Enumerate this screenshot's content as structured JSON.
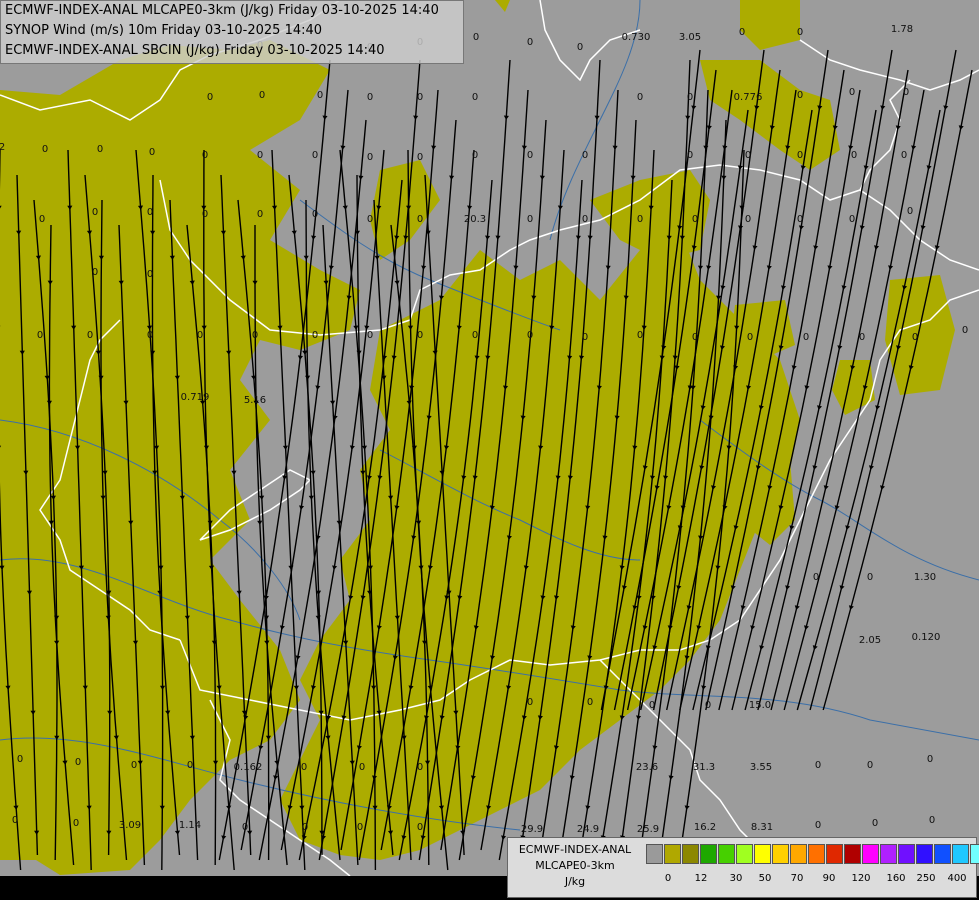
{
  "header": {
    "line1": "ECMWF-INDEX-ANAL MLCAPE0-3km (J/kg) Friday 03-10-2025 14:40",
    "line2": "SYNOP Wind (m/s) 10m Friday 03-10-2025 14:40",
    "line3": "ECMWF-INDEX-ANAL SBCIN (J/kg) Friday 03-10-2025 14:40"
  },
  "legend": {
    "title1": "ECMWF-INDEX-ANAL",
    "title2": "MLCAPE0-3km",
    "unit": "J/kg",
    "colors": [
      "#9a9a9a",
      "#b0a800",
      "#8c8800",
      "#1ea800",
      "#46d000",
      "#a0ff20",
      "#ffff00",
      "#ffd000",
      "#ffa800",
      "#ff7000",
      "#e02800",
      "#b00000",
      "#ff00ff",
      "#b020ff",
      "#7010ff",
      "#3010ff",
      "#1050ff",
      "#20c8ff",
      "#70ffff",
      "#ffffff"
    ],
    "ticks": [
      "0",
      "12",
      "30",
      "50",
      "70",
      "90",
      "120",
      "160",
      "250",
      "400"
    ]
  },
  "colors": {
    "background": "#9c9c9c",
    "cape_fill": "#acac00",
    "borders": "#ffffff",
    "rivers": "#3b6fa8",
    "streamlines": "#000000"
  },
  "station_values": [
    "0.730",
    "3.05",
    "0",
    "0",
    "1.78",
    "0",
    "0",
    "0",
    "0",
    "0",
    "0",
    "0",
    "0.776",
    "0",
    "0",
    "0",
    "0",
    "0",
    "0",
    "0",
    "0",
    "0",
    "0",
    "0",
    "0",
    "0",
    "0",
    "0",
    "2",
    "0",
    "0",
    "0",
    "0",
    "0",
    "0",
    "0",
    "0",
    "0",
    "0",
    "0",
    "0",
    "20.3",
    "0",
    "0",
    "0",
    "0",
    "0",
    "0",
    "0",
    "0",
    "0",
    "0",
    "0",
    "0",
    "0",
    "0",
    "0",
    "0",
    "0",
    "0",
    "0.719",
    "5.16",
    "0",
    "0",
    "0",
    "0",
    "0",
    "0",
    "0",
    "0",
    "0",
    "0",
    "0",
    "0",
    "0",
    "0",
    "0",
    "0",
    "0",
    "0",
    "1.30",
    "2.05",
    "0.120",
    "0",
    "0",
    "15.0",
    "0",
    "0",
    "23.6",
    "31.3",
    "3.55",
    "0",
    "0",
    "0",
    "0.162",
    "0",
    "0",
    "0",
    "0",
    "0",
    "3.09",
    "1.14",
    "0",
    "0",
    "0",
    "0",
    "29.9",
    "24.9",
    "25.9",
    "16.2",
    "8.31",
    "0",
    "0",
    "0",
    "0",
    "0",
    "0",
    "0",
    "0",
    "0"
  ]
}
